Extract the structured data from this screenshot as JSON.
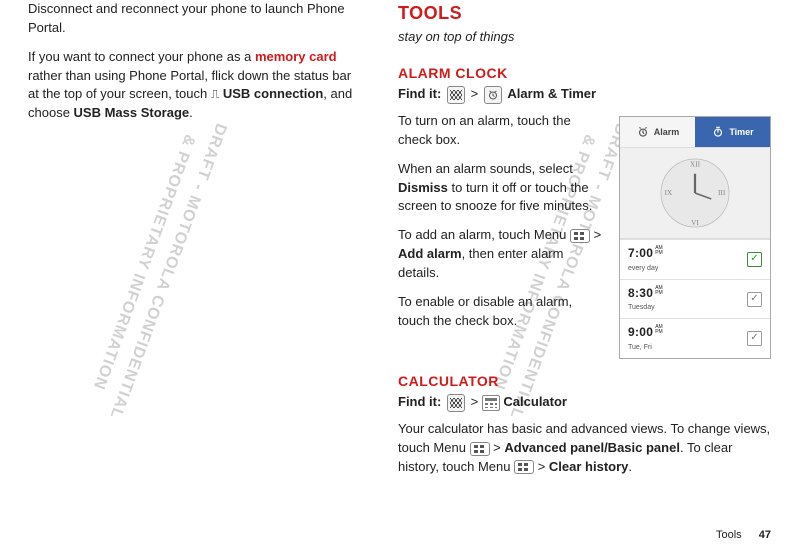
{
  "watermark": "DRAFT - MOTOROLA CONFIDENTIAL\n& PROPRIETARY INFORMATION",
  "left": {
    "p1a": "Disconnect and reconnect your phone to launch Phone Portal.",
    "p2_pre": "If you want to connect your phone as a ",
    "p2_mem": "memory card",
    "p2_mid": " rather than using Phone Portal, flick down the status bar at the top of your screen, touch ",
    "p2_usb_glyph": "⎍",
    "p2_usb": " USB connection",
    "p2_mid2": ", and choose ",
    "p2_mass": "USB Mass Storage",
    "p2_end": "."
  },
  "right": {
    "tools": "TOOLS",
    "tagline": "stay on top of things",
    "alarm_h": "ALARM CLOCK",
    "findit": "Find it:",
    "alarm_find_tail": " Alarm & Timer",
    "a_p1": "To turn on an alarm, touch the check box.",
    "a_p2_pre": "When an alarm sounds, select ",
    "a_p2_dismiss": "Dismiss",
    "a_p2_post": " to turn it off or touch the screen to snooze for five minutes.",
    "a_p3_pre": "To add an alarm, touch Menu ",
    "a_p3_add": " > ",
    "a_p3_addalarm": "Add alarm",
    "a_p3_post": ", then enter alarm details.",
    "a_p4": "To enable or disable an alarm, touch the check box.",
    "calc_h": "CALCULATOR",
    "calc_find_tail": " Calculator",
    "c_p1_pre": "Your calculator has basic and advanced views. To change views, touch Menu ",
    "c_p1_adv": "Advanced panel/Basic panel",
    "c_p1_mid": ". To clear history, touch Menu ",
    "c_p1_clear": "Clear history",
    "gt": " > ",
    "period": "."
  },
  "phone": {
    "tab_alarm": "Alarm",
    "tab_timer": "Timer",
    "rows": [
      {
        "time": "7:00",
        "ampm": "AM",
        "rep": "every day",
        "on": true
      },
      {
        "time": "8:30",
        "ampm": "AM",
        "rep": "Tuesday",
        "on": false
      },
      {
        "time": "9:00",
        "ampm": "AM",
        "rep": "Tue, Fri",
        "on": false
      }
    ]
  },
  "footer": {
    "label": "Tools",
    "page": "47"
  }
}
